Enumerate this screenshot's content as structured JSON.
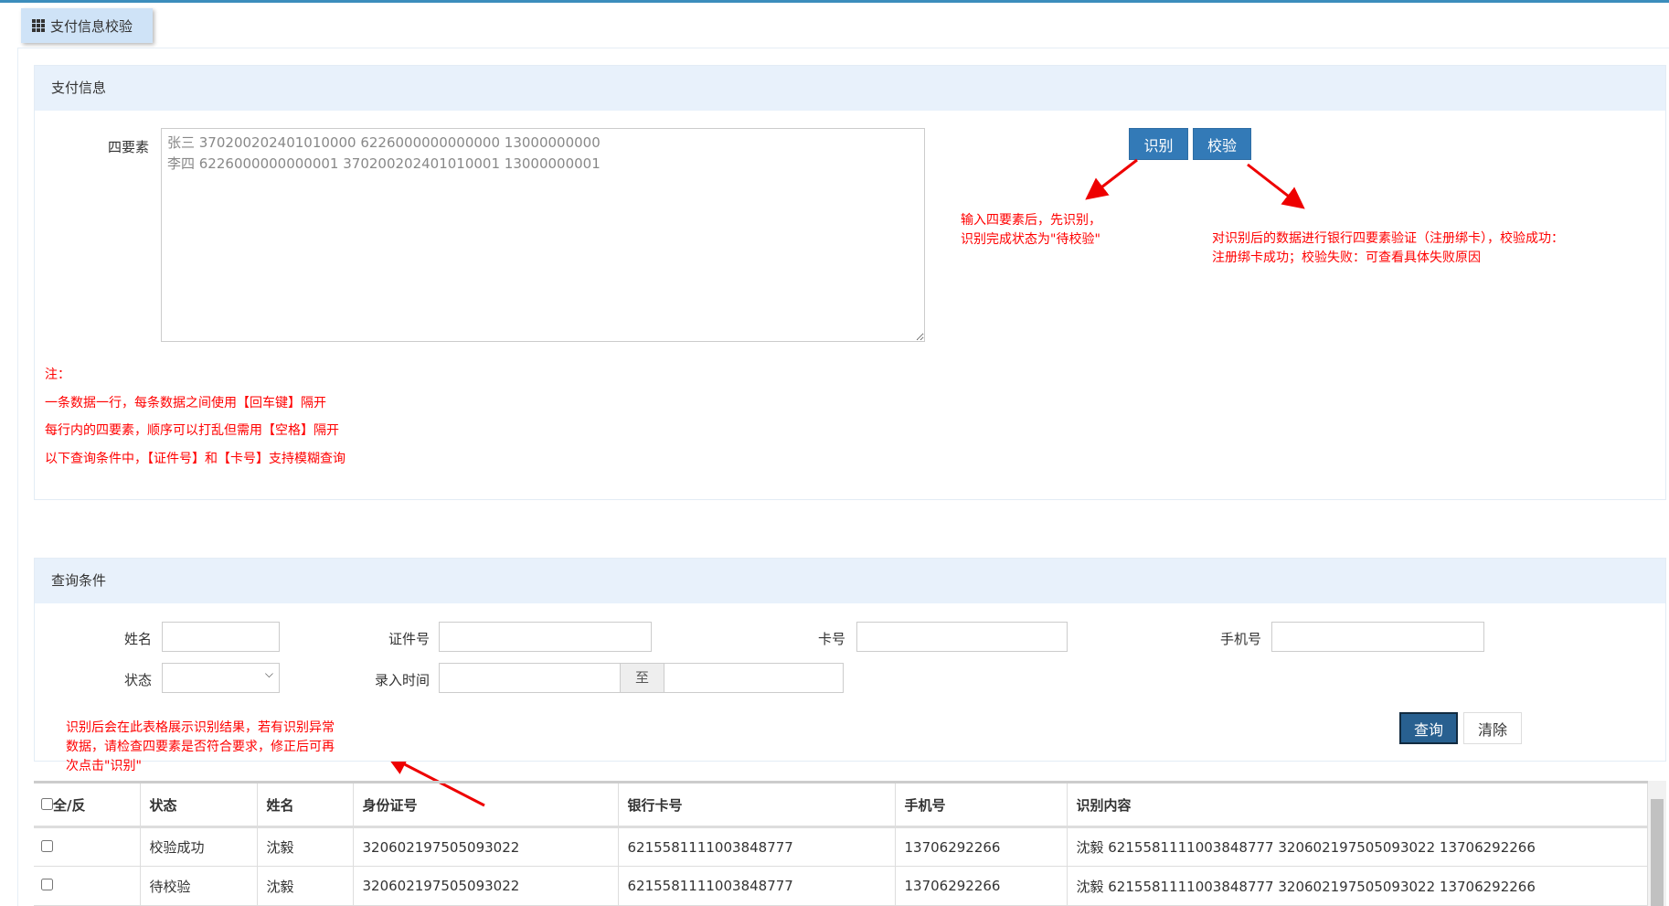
{
  "tab": {
    "label": "支付信息校验",
    "icon": "grid-icon"
  },
  "pay": {
    "title": "支付信息",
    "label": "四要素",
    "text": "张三 370200202401010000 6226000000000000 13000000000\n李四 6226000000000001 370200202401010001 13000000001",
    "identify": "识别",
    "verify": "校验",
    "tip1": [
      "输入四要素后，先识别，",
      "识别完成状态为\"待校验\""
    ],
    "tip2": [
      "对识别后的数据进行银行四要素验证（注册绑卡），校验成功：",
      "注册绑卡成功；校验失败：可查看具体失败原因"
    ],
    "notes": [
      "注：",
      "一条数据一行，每条数据之间使用【回车键】隔开",
      "每行内的四要素，顺序可以打乱但需用【空格】隔开",
      "以下查询条件中，【证件号】和【卡号】支持模糊查询"
    ]
  },
  "query": {
    "title": "查询条件",
    "name": "姓名",
    "id": "证件号",
    "card": "卡号",
    "phone": "手机号",
    "status": "状态",
    "time": "录入时间",
    "to": "至",
    "search": "查询",
    "clear": "清除",
    "tip": [
      "识别后会在此表格展示识别结果，若有识别异常",
      "数据，请检查四要素是否符合要求，修正后可再",
      "次点击\"识别\""
    ]
  },
  "table": {
    "headers": [
      "全/反",
      "状态",
      "姓名",
      "身份证号",
      "银行卡号",
      "手机号",
      "识别内容"
    ],
    "rows": [
      [
        "校验成功",
        "沈毅",
        "320602197505093022",
        "6215581111003848777",
        "13706292266",
        "沈毅 6215581111003848777 320602197505093022 13706292266"
      ],
      [
        "待校验",
        "沈毅",
        "320602197505093022",
        "6215581111003848777",
        "13706292266",
        "沈毅 6215581111003848777 320602197505093022 13706292266"
      ]
    ]
  },
  "colors": {
    "accent": "#337ab7",
    "annotation": "#ff0000"
  }
}
